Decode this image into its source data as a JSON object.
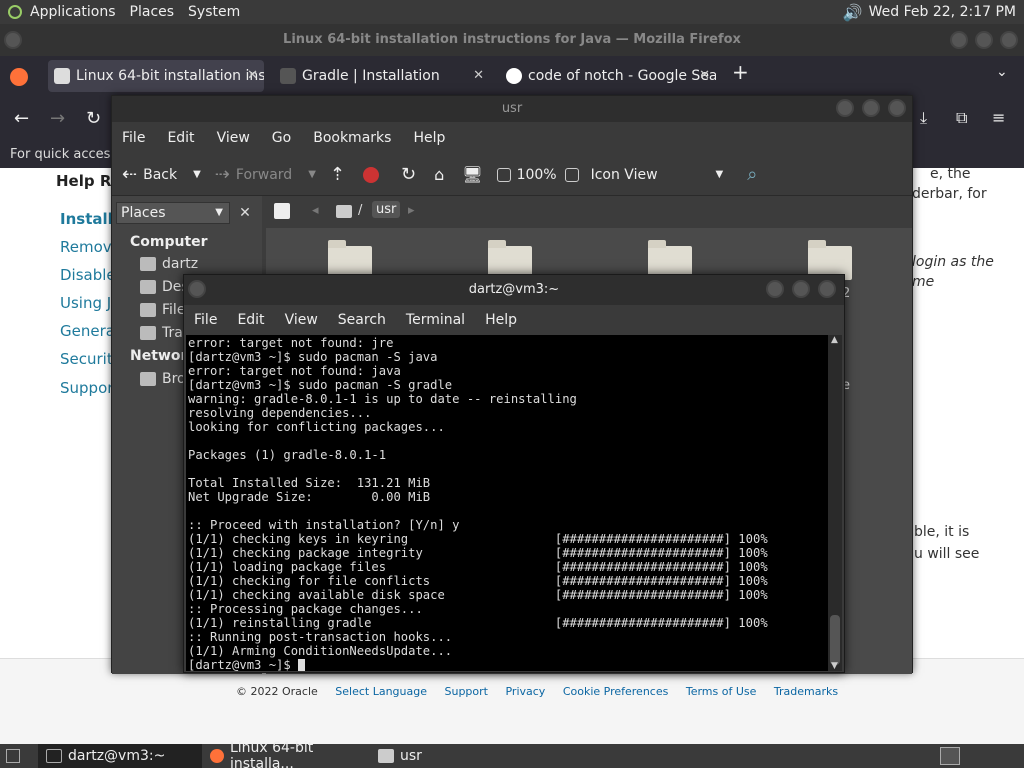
{
  "top_panel": {
    "menus": [
      "Applications",
      "Places",
      "System"
    ],
    "clock": "Wed Feb 22,  2:17 PM"
  },
  "firefox": {
    "title": "Linux 64-bit installation instructions for Java — Mozilla Firefox",
    "tabs": [
      {
        "label": "Linux 64-bit installation inst",
        "active": true
      },
      {
        "label": "Gradle | Installation",
        "active": false
      },
      {
        "label": "code of notch - Google Sear",
        "active": false
      }
    ],
    "new_tab": "+",
    "bookmarks_text": "For quick access,",
    "help_heading": "Help Re",
    "sidebar_links": [
      "Installi",
      "Remove",
      "Disable",
      "Using Ja",
      "General",
      "Security",
      "Support"
    ],
    "right_text_1": "e, the",
    "right_text_2": "derbar, for",
    "right_text_3": "login as the",
    "right_text_4": "me",
    "right_text_5": "ble, it is",
    "right_text_6": "u will see",
    "footer_links": [
      "© 2022 Oracle",
      "Select Language",
      "Support",
      "Privacy",
      "Cookie Preferences",
      "Terms of Use",
      "Trademarks"
    ]
  },
  "nautilus": {
    "title": "usr",
    "menu": [
      "File",
      "Edit",
      "View",
      "Go",
      "Bookmarks",
      "Help"
    ],
    "toolbar": {
      "back": "Back",
      "forward": "Forward",
      "zoom": "100%",
      "view_mode": "Icon View"
    },
    "places_label": "Places",
    "path_sep": "/",
    "path_current": "usr",
    "sidebar": {
      "computer_heading": "Computer",
      "items": [
        "dartz",
        "Des",
        "File",
        "Tra"
      ],
      "network_heading": "Network",
      "network_items": [
        "Bro"
      ]
    },
    "partial_label_1": "2",
    "partial_label_2": "e"
  },
  "terminal": {
    "title": "dartz@vm3:~",
    "menu": [
      "File",
      "Edit",
      "View",
      "Search",
      "Terminal",
      "Help"
    ],
    "lines": [
      "error: target not found: jre",
      "[dartz@vm3 ~]$ sudo pacman -S java",
      "error: target not found: java",
      "[dartz@vm3 ~]$ sudo pacman -S gradle",
      "warning: gradle-8.0.1-1 is up to date -- reinstalling",
      "resolving dependencies...",
      "looking for conflicting packages...",
      "",
      "Packages (1) gradle-8.0.1-1",
      "",
      "Total Installed Size:  131.21 MiB",
      "Net Upgrade Size:        0.00 MiB",
      "",
      ":: Proceed with installation? [Y/n] y",
      "(1/1) checking keys in keyring                    [######################] 100%",
      "(1/1) checking package integrity                  [######################] 100%",
      "(1/1) loading package files                       [######################] 100%",
      "(1/1) checking for file conflicts                 [######################] 100%",
      "(1/1) checking available disk space               [######################] 100%",
      ":: Processing package changes...",
      "(1/1) reinstalling gradle                         [######################] 100%",
      ":: Running post-transaction hooks...",
      "(1/1) Arming ConditionNeedsUpdate...",
      "[dartz@vm3 ~]$ "
    ]
  },
  "bottom_panel": {
    "tasks": [
      {
        "label": "dartz@vm3:~",
        "active": true
      },
      {
        "label": "Linux 64-bit installa...",
        "active": false
      },
      {
        "label": "usr",
        "active": false
      }
    ]
  }
}
